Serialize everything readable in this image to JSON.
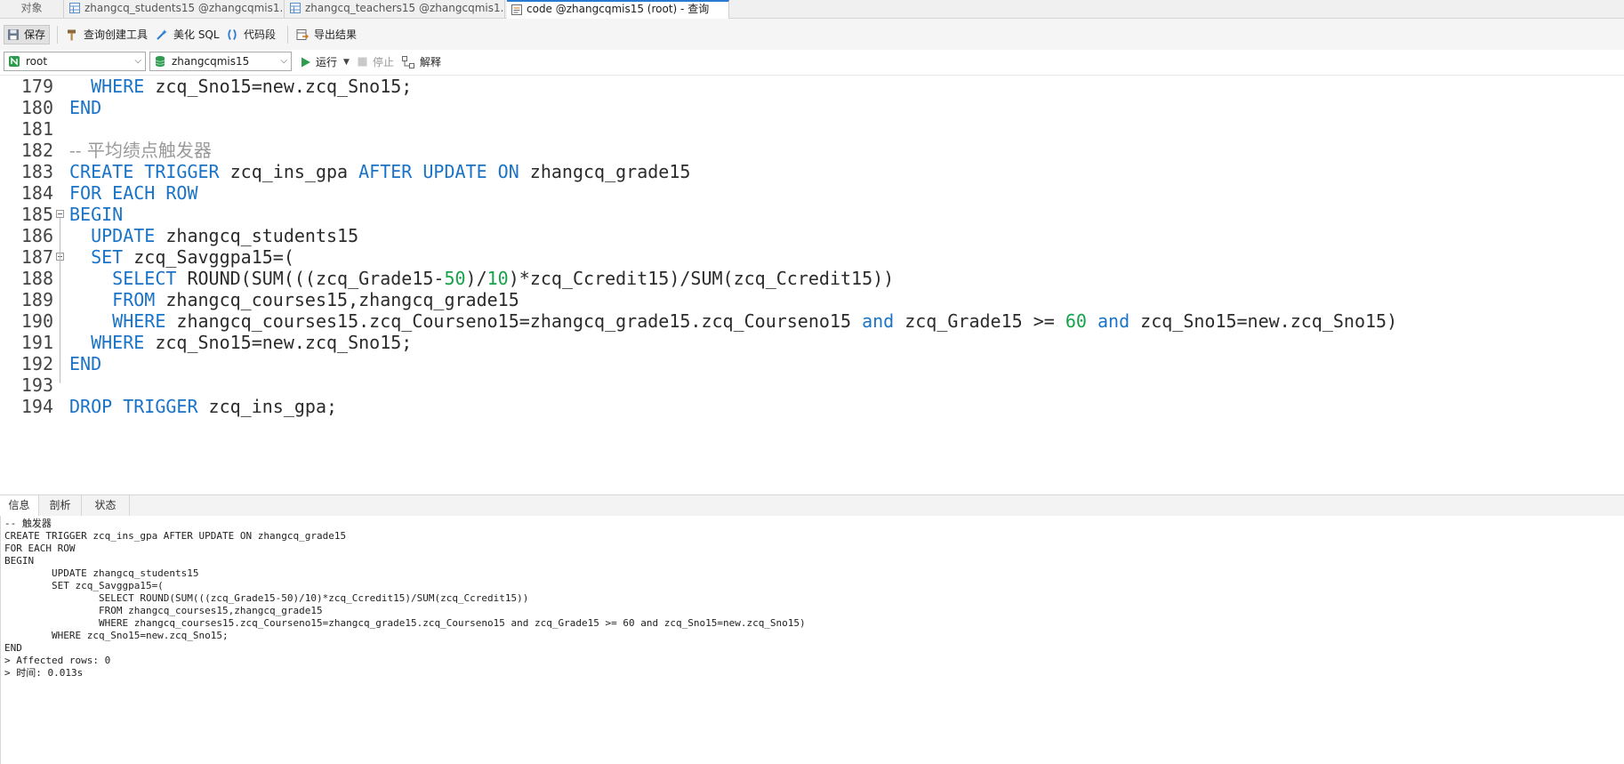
{
  "tabs": {
    "objects": "对象",
    "t1": "zhangcq_students15 @zhangcqmis1...",
    "t2": "zhangcq_teachers15 @zhangcqmis1...",
    "t3": "code @zhangcqmis15 (root) - 查询"
  },
  "toolbar": {
    "save": "保存",
    "query_builder": "查询创建工具",
    "beautify": "美化 SQL",
    "snippet": "代码段",
    "export": "导出结果"
  },
  "bar2": {
    "connection": "root",
    "database": "zhangcqmis15",
    "run": "运行",
    "stop": "停止",
    "explain": "解释"
  },
  "editor_lines": [
    {
      "n": "179",
      "segs": [
        [
          "p",
          "  "
        ],
        [
          "k",
          "WHERE"
        ],
        [
          "p",
          " zcq_Sno15=new.zcq_Sno15;"
        ]
      ]
    },
    {
      "n": "180",
      "segs": [
        [
          "k",
          "END"
        ]
      ]
    },
    {
      "n": "181",
      "segs": []
    },
    {
      "n": "182",
      "segs": [
        [
          "c",
          "-- 平均绩点触发器"
        ]
      ]
    },
    {
      "n": "183",
      "segs": [
        [
          "k",
          "CREATE TRIGGER"
        ],
        [
          "p",
          " zcq_ins_gpa "
        ],
        [
          "k",
          "AFTER UPDATE ON"
        ],
        [
          "p",
          " zhangcq_grade15"
        ]
      ]
    },
    {
      "n": "184",
      "segs": [
        [
          "k",
          "FOR EACH ROW"
        ]
      ]
    },
    {
      "n": "185",
      "segs": [
        [
          "k",
          "BEGIN"
        ]
      ]
    },
    {
      "n": "186",
      "segs": [
        [
          "p",
          "  "
        ],
        [
          "k",
          "UPDATE"
        ],
        [
          "p",
          " zhangcq_students15"
        ]
      ]
    },
    {
      "n": "187",
      "segs": [
        [
          "p",
          "  "
        ],
        [
          "k",
          "SET"
        ],
        [
          "p",
          " zcq_Savggpa15=("
        ]
      ]
    },
    {
      "n": "188",
      "segs": [
        [
          "p",
          "    "
        ],
        [
          "k",
          "SELECT"
        ],
        [
          "p",
          " ROUND(SUM(((zcq_Grade15-"
        ],
        [
          "n",
          "50"
        ],
        [
          "p",
          ")/"
        ],
        [
          "n",
          "10"
        ],
        [
          "p",
          ")*zcq_Ccredit15)/SUM(zcq_Ccredit15))"
        ]
      ]
    },
    {
      "n": "189",
      "segs": [
        [
          "p",
          "    "
        ],
        [
          "k",
          "FROM"
        ],
        [
          "p",
          " zhangcq_courses15,zhangcq_grade15"
        ]
      ]
    },
    {
      "n": "190",
      "segs": [
        [
          "p",
          "    "
        ],
        [
          "k",
          "WHERE"
        ],
        [
          "p",
          " zhangcq_courses15.zcq_Courseno15=zhangcq_grade15.zcq_Courseno15 "
        ],
        [
          "k",
          "and"
        ],
        [
          "p",
          " zcq_Grade15 >= "
        ],
        [
          "n",
          "60"
        ],
        [
          "p",
          " "
        ],
        [
          "k",
          "and"
        ],
        [
          "p",
          " zcq_Sno15=new.zcq_Sno15)"
        ]
      ]
    },
    {
      "n": "191",
      "segs": [
        [
          "p",
          "  "
        ],
        [
          "k",
          "WHERE"
        ],
        [
          "p",
          " zcq_Sno15=new.zcq_Sno15;"
        ]
      ]
    },
    {
      "n": "192",
      "segs": [
        [
          "k",
          "END"
        ]
      ]
    },
    {
      "n": "193",
      "segs": []
    },
    {
      "n": "194",
      "segs": [
        [
          "k",
          "DROP TRIGGER"
        ],
        [
          "p",
          " zcq_ins_gpa;"
        ]
      ]
    }
  ],
  "panel_tabs": [
    "信息",
    "剖析",
    "状态"
  ],
  "output_lines": [
    "-- 触发器",
    "CREATE TRIGGER zcq_ins_gpa AFTER UPDATE ON zhangcq_grade15",
    "FOR EACH ROW",
    "BEGIN",
    "        UPDATE zhangcq_students15",
    "        SET zcq_Savggpa15=(",
    "                SELECT ROUND(SUM(((zcq_Grade15-50)/10)*zcq_Ccredit15)/SUM(zcq_Ccredit15))",
    "                FROM zhangcq_courses15,zhangcq_grade15",
    "                WHERE zhangcq_courses15.zcq_Courseno15=zhangcq_grade15.zcq_Courseno15 and zcq_Grade15 >= 60 and zcq_Sno15=new.zcq_Sno15)",
    "        WHERE zcq_Sno15=new.zcq_Sno15;",
    "END",
    "> Affected rows: 0",
    "> 时间: 0.013s"
  ],
  "colors": {
    "keyword": "#1a73c7",
    "number": "#17a34a",
    "comment": "#9a9a9a",
    "accent": "#2a7ad2"
  }
}
